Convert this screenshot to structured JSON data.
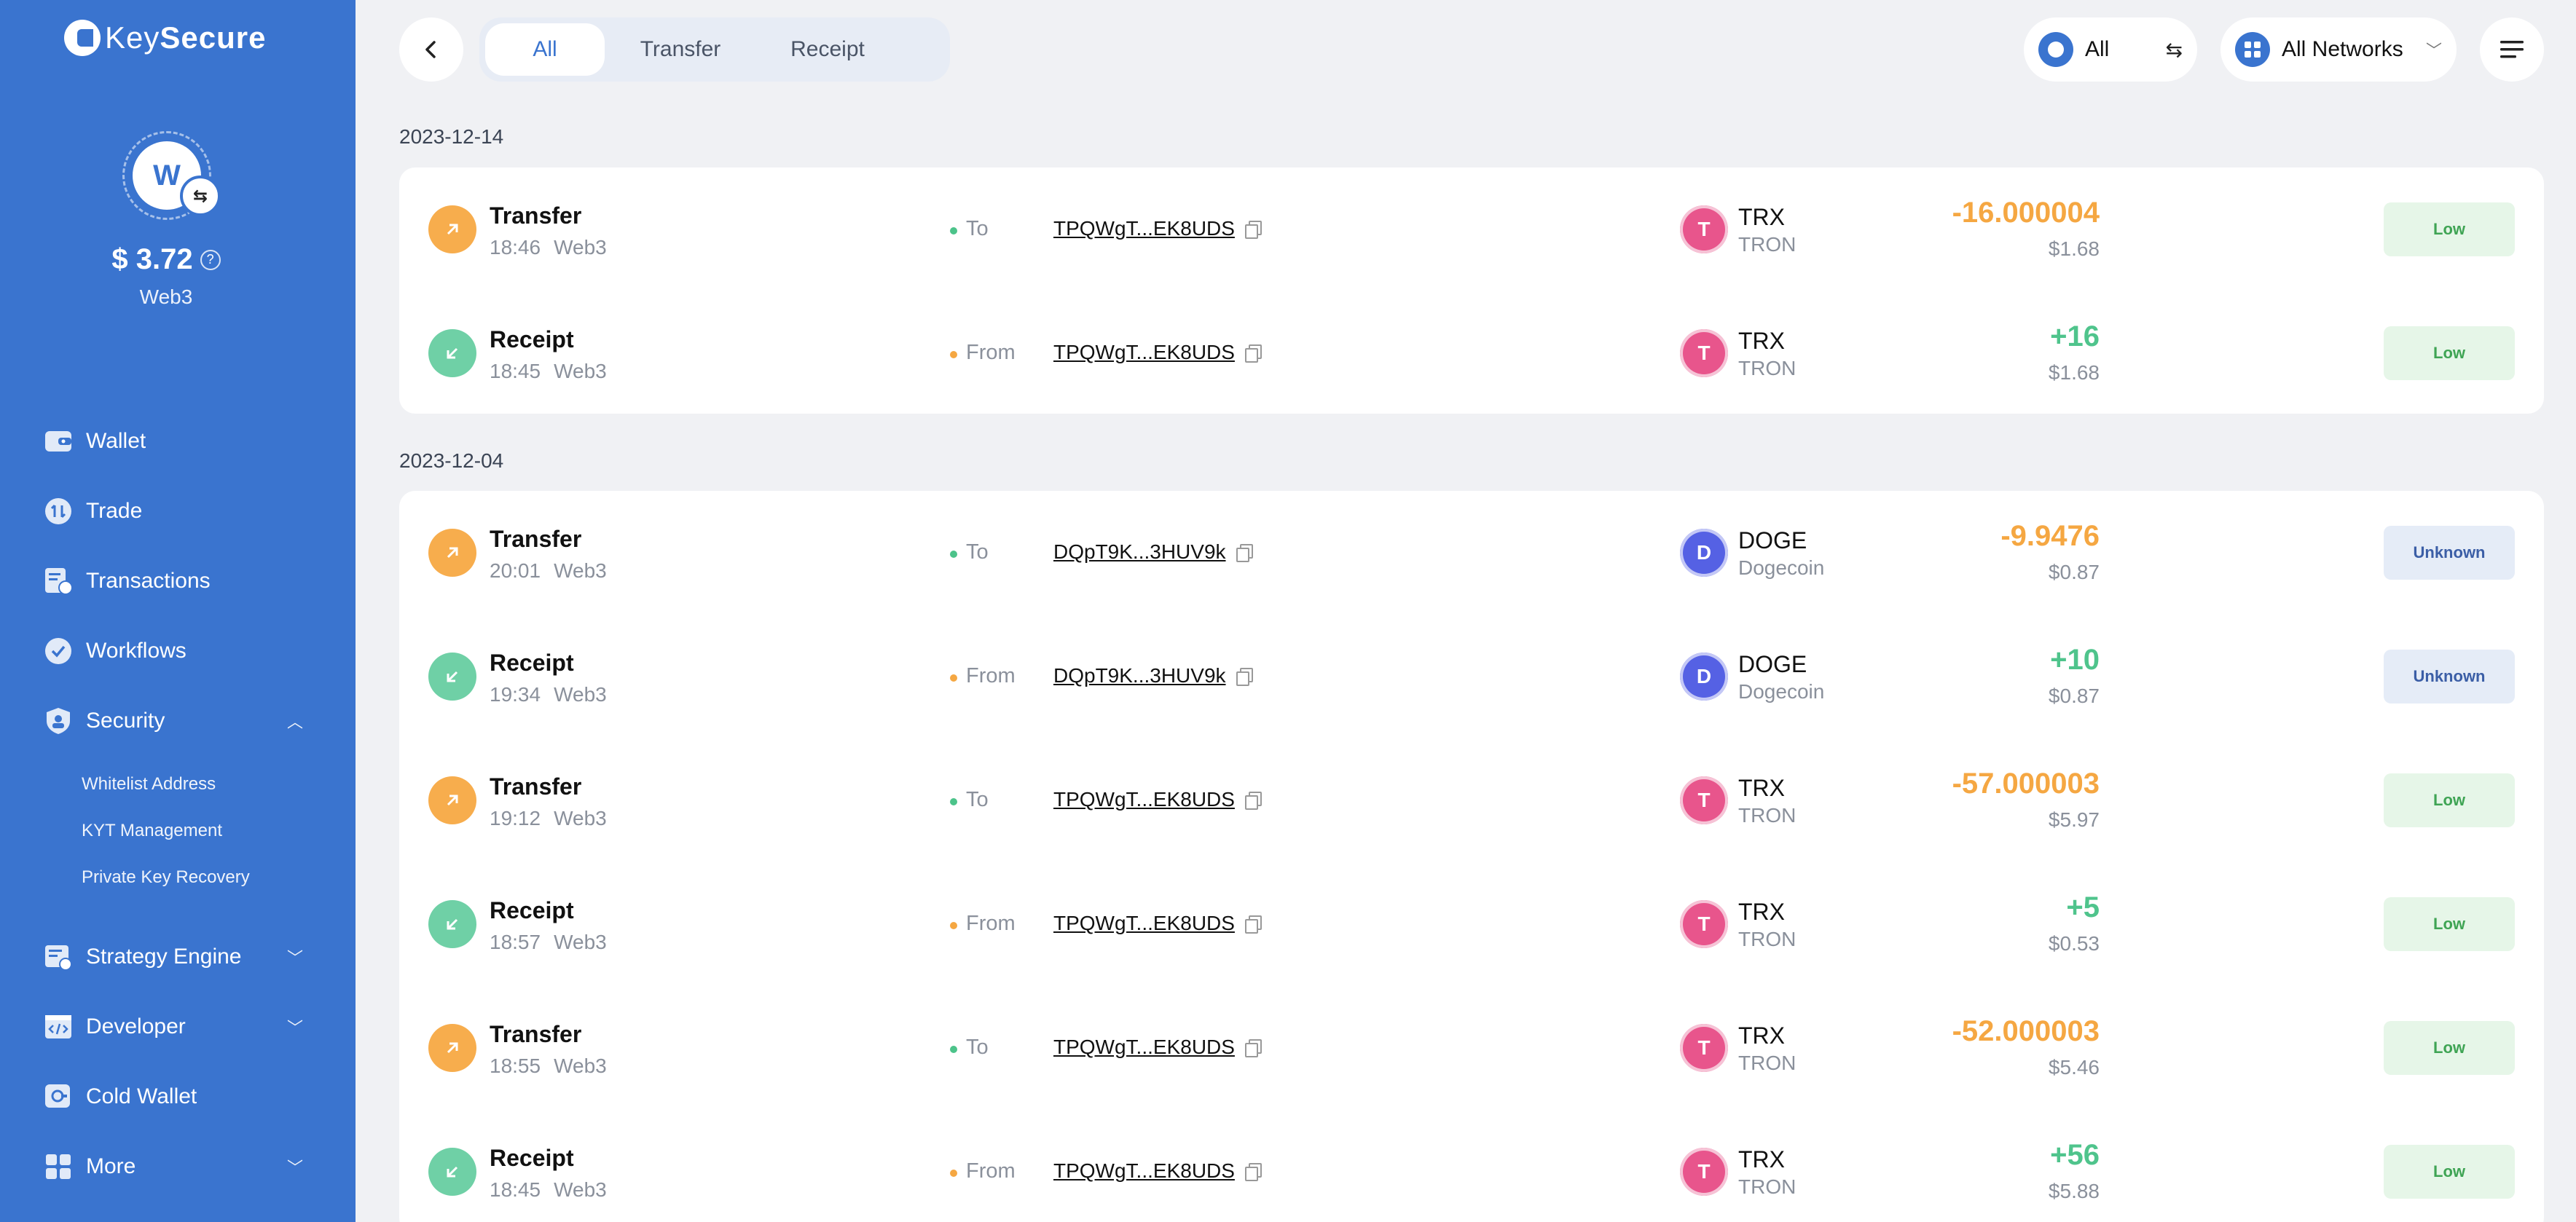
{
  "app": {
    "brand": "KeySecure",
    "brand_prefix": "Key",
    "brand_suffix": "Secure"
  },
  "account": {
    "avatar_letter": "W",
    "balance": "$ 3.72",
    "name": "Web3"
  },
  "sidebar": {
    "items": [
      {
        "label": "Wallet",
        "icon": "wallet-icon"
      },
      {
        "label": "Trade",
        "icon": "trade-icon"
      },
      {
        "label": "Transactions",
        "icon": "transactions-icon"
      },
      {
        "label": "Workflows",
        "icon": "workflows-icon"
      },
      {
        "label": "Security",
        "icon": "shield-icon",
        "expanded": true
      },
      {
        "label": "Strategy Engine",
        "icon": "strategy-icon"
      },
      {
        "label": "Developer",
        "icon": "developer-icon"
      },
      {
        "label": "Cold Wallet",
        "icon": "cold-wallet-icon"
      },
      {
        "label": "More",
        "icon": "grid-icon"
      }
    ],
    "security_sub": [
      "Whitelist Address",
      "KYT Management",
      "Private Key Recovery"
    ]
  },
  "filters": {
    "tabs": [
      "All",
      "Transfer",
      "Receipt"
    ],
    "active_tab": "All",
    "asset": "All",
    "network": "All Networks"
  },
  "colors": {
    "sidebar": "#3a74cf",
    "negative": "#f5a742",
    "positive": "#4fc48c",
    "trx": "#e8558c",
    "doge": "#5561e4"
  },
  "groups": [
    {
      "date": "2023-12-14",
      "rows": [
        {
          "type": "Transfer",
          "time": "18:46",
          "account": "Web3",
          "dir": "To",
          "address": "TPQWgT...EK8UDS",
          "coin_letter": "T",
          "coin": "TRX",
          "chain": "TRON",
          "amount": "-16.000004",
          "usd": "$1.68",
          "risk": "Low"
        },
        {
          "type": "Receipt",
          "time": "18:45",
          "account": "Web3",
          "dir": "From",
          "address": "TPQWgT...EK8UDS",
          "coin_letter": "T",
          "coin": "TRX",
          "chain": "TRON",
          "amount": "+16",
          "usd": "$1.68",
          "risk": "Low"
        }
      ]
    },
    {
      "date": "2023-12-04",
      "rows": [
        {
          "type": "Transfer",
          "time": "20:01",
          "account": "Web3",
          "dir": "To",
          "address": "DQpT9K...3HUV9k",
          "coin_letter": "D",
          "coin": "DOGE",
          "chain": "Dogecoin",
          "amount": "-9.9476",
          "usd": "$0.87",
          "risk": "Unknown"
        },
        {
          "type": "Receipt",
          "time": "19:34",
          "account": "Web3",
          "dir": "From",
          "address": "DQpT9K...3HUV9k",
          "coin_letter": "D",
          "coin": "DOGE",
          "chain": "Dogecoin",
          "amount": "+10",
          "usd": "$0.87",
          "risk": "Unknown"
        },
        {
          "type": "Transfer",
          "time": "19:12",
          "account": "Web3",
          "dir": "To",
          "address": "TPQWgT...EK8UDS",
          "coin_letter": "T",
          "coin": "TRX",
          "chain": "TRON",
          "amount": "-57.000003",
          "usd": "$5.97",
          "risk": "Low"
        },
        {
          "type": "Receipt",
          "time": "18:57",
          "account": "Web3",
          "dir": "From",
          "address": "TPQWgT...EK8UDS",
          "coin_letter": "T",
          "coin": "TRX",
          "chain": "TRON",
          "amount": "+5",
          "usd": "$0.53",
          "risk": "Low"
        },
        {
          "type": "Transfer",
          "time": "18:55",
          "account": "Web3",
          "dir": "To",
          "address": "TPQWgT...EK8UDS",
          "coin_letter": "T",
          "coin": "TRX",
          "chain": "TRON",
          "amount": "-52.000003",
          "usd": "$5.46",
          "risk": "Low"
        },
        {
          "type": "Receipt",
          "time": "18:45",
          "account": "Web3",
          "dir": "From",
          "address": "TPQWgT...EK8UDS",
          "coin_letter": "T",
          "coin": "TRX",
          "chain": "TRON",
          "amount": "+56",
          "usd": "$5.88",
          "risk": "Low"
        }
      ]
    }
  ]
}
